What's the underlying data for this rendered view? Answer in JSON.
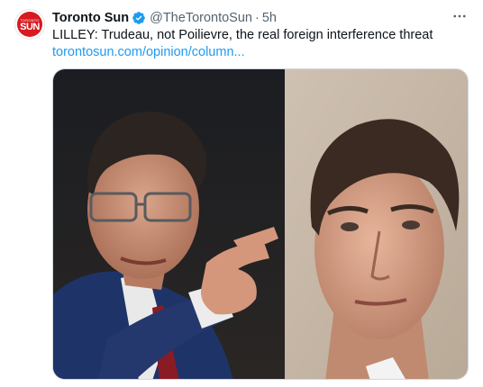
{
  "account": {
    "name": "Toronto Sun",
    "handle": "@TheTorontoSun",
    "separator": "·",
    "time": "5h",
    "avatar_small_text": "TORONTO",
    "avatar_text": "SUN",
    "verified_color": "#1d9bf0",
    "brand_color": "#d71920"
  },
  "tweet": {
    "text": "LILLEY: Trudeau, not Poilievre, the real foreign interference threat",
    "link": "torontosun.com/opinion/column..."
  },
  "icons": {
    "more": "more-icon",
    "verified": "verified-badge-icon"
  }
}
